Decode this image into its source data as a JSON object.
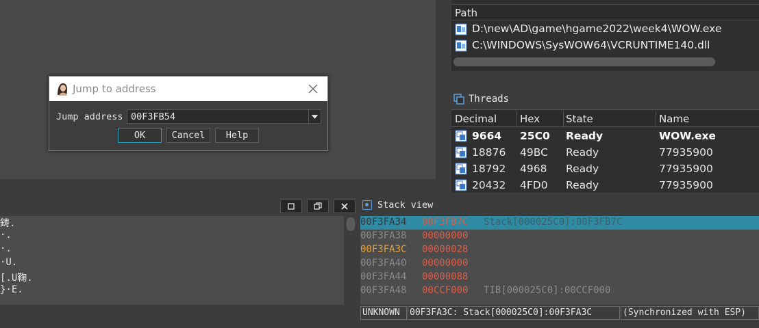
{
  "modules": {
    "header": "Path",
    "rows": [
      "D:\\new\\AD\\game\\hgame2022\\week4\\WOW.exe",
      "C:\\WINDOWS\\SysWOW64\\VCRUNTIME140.dll"
    ]
  },
  "threads": {
    "title": "Threads",
    "columns": [
      "Decimal",
      "Hex",
      "State",
      "Name"
    ],
    "rows": [
      {
        "decimal": "9664",
        "hex": "25C0",
        "state": "Ready",
        "name": "WOW.exe"
      },
      {
        "decimal": "18876",
        "hex": "49BC",
        "state": "Ready",
        "name": "77935900"
      },
      {
        "decimal": "18792",
        "hex": "4968",
        "state": "Ready",
        "name": "77935900"
      },
      {
        "decimal": "20432",
        "hex": "4FD0",
        "state": "Ready",
        "name": "77935900"
      }
    ]
  },
  "dialog": {
    "title": "Jump to address",
    "label": "Jump address",
    "value": "00F3FB54",
    "ok": "OK",
    "cancel": "Cancel",
    "help": "Help"
  },
  "dump": {
    "lines": [
      "鋳.",
      "·.",
      "·.",
      "·U.",
      "[.U鞠.",
      "}·E."
    ]
  },
  "stack": {
    "title": "Stack view",
    "rows": [
      {
        "addr": "00F3FA34",
        "val": "00F3FB7C",
        "cmt": "Stack[000025C0]:00F3FB7C"
      },
      {
        "addr": "00F3FA38",
        "val": "00000000",
        "cmt": ""
      },
      {
        "addr": "00F3FA3C",
        "val": "00000028",
        "cmt": ""
      },
      {
        "addr": "00F3FA40",
        "val": "00000000",
        "cmt": ""
      },
      {
        "addr": "00F3FA44",
        "val": "00000088",
        "cmt": ""
      },
      {
        "addr": "00F3FA48",
        "val": "00CCF000",
        "cmt": "TIB[000025C0]:00CCF000"
      }
    ],
    "selected_row": 0,
    "highlight_addr_row": 2
  },
  "status": {
    "cells": [
      "UNKNOWN",
      "00F3FA3C: Stack[000025C0]:00F3FA3C",
      "(Synchronized with ESP)"
    ]
  },
  "colors": {
    "selection": "#2e8ba3",
    "value_red": "#e05a46",
    "addr_orange": "#e8a23a"
  }
}
